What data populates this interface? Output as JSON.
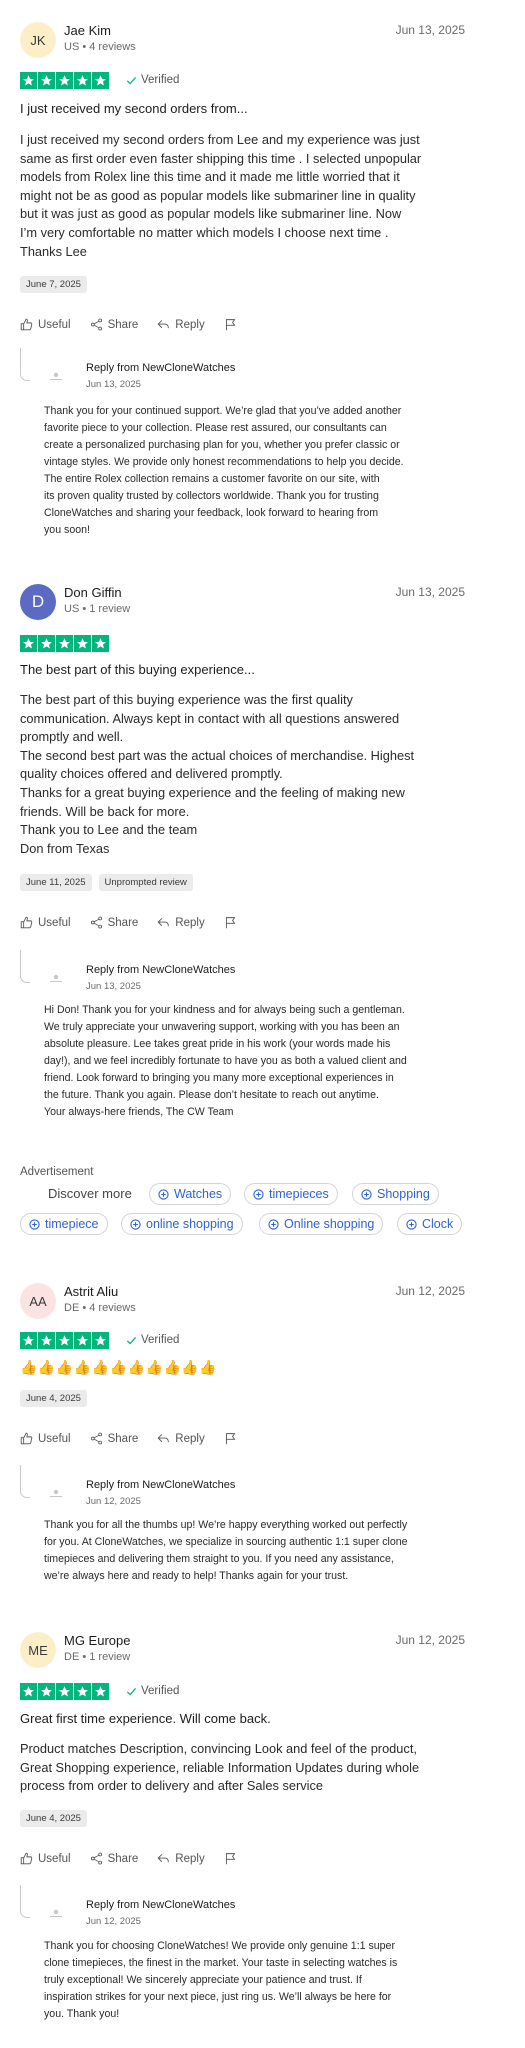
{
  "reviews": [
    {
      "initials": "JK",
      "avatar_color": "#fcefc7",
      "name": "Jae Kim",
      "meta": "US • 4 reviews",
      "date": "Jun 13, 2025",
      "rating": 5,
      "verified": "Verified",
      "title": "I just received my second orders from...",
      "body_lines": [
        "I just received my second orders from Lee and my experience was just",
        "same as first order even faster shipping this time . I selected unpopular",
        "models from Rolex line this time and it made me little worried that it",
        "might not be as good as popular models like submariner line in quality",
        "but it was just as good as popular models like submariner line. Now",
        "I’m very comfortable no matter which models I choose next time .",
        "Thanks Lee"
      ],
      "chips": [
        "June 7, 2025"
      ],
      "actions": {
        "useful": "Useful",
        "share": "Share",
        "reply": "Reply"
      },
      "reply": {
        "title": "Reply from NewCloneWatches",
        "date": "Jun 13, 2025",
        "lines": [
          "Thank you for your continued support. We’re glad that you’ve added another",
          "favorite piece to your collection. Please rest assured, our consultants can",
          "create a personalized purchasing plan for you, whether you prefer classic or",
          "vintage styles. We provide only honest recommendations to help you decide.",
          "The entire Rolex collection remains a customer favorite on our site, with",
          "its proven quality trusted by collectors worldwide. Thank you for trusting",
          "CloneWatches and sharing your feedback, look forward to hearing from",
          "you soon!"
        ]
      }
    },
    {
      "initials": "D",
      "avatar_color": "#5b6bc4",
      "name": "Don Giffin",
      "meta": "US • 1 review",
      "date": "Jun 13, 2025",
      "rating": 5,
      "title": "The best part of this buying experience...",
      "body_lines": [
        "The best part of this buying experience was the first quality",
        "communication. Always kept in contact with all questions answered",
        "promptly and well.",
        "The second best part was the actual choices of merchandise. Highest",
        "quality choices offered and delivered promptly.",
        "Thanks for a great buying experience and the feeling of making new",
        "friends. Will be back for more.",
        "Thank you to Lee and the team",
        "Don from Texas"
      ],
      "chips": [
        "June 11, 2025",
        "Unprompted review"
      ],
      "actions": {
        "useful": "Useful",
        "share": "Share",
        "reply": "Reply"
      },
      "reply": {
        "title": "Reply from NewCloneWatches",
        "date": "Jun 13, 2025",
        "lines": [
          "Hi Don! Thank you for your kindness and for always being such a gentleman.",
          "We truly appreciate your unwavering support, working with you has been an",
          "absolute pleasure. Lee takes great pride in his work (your words made his",
          "day!), and we feel incredibly fortunate to have you as both a valued client and",
          "friend. Look forward to bringing you many more exceptional experiences in",
          "the future. Thank you again. Please don’t hesitate to reach out anytime.",
          "Your always-here friends, The CW Team"
        ]
      }
    },
    {
      "initials": "AA",
      "avatar_color": "#fbe3e3",
      "name": "Astrit Aliu",
      "meta": "DE • 4 reviews",
      "date": "Jun 12, 2025",
      "rating": 5,
      "verified": "Verified",
      "thumbs": "👍👍👍👍👍👍👍👍👍👍👍",
      "chips": [
        "June 4, 2025"
      ],
      "actions": {
        "useful": "Useful",
        "share": "Share",
        "reply": "Reply"
      },
      "reply": {
        "title": "Reply from NewCloneWatches",
        "date": "Jun 12, 2025",
        "lines": [
          "Thank you for all the thumbs up! We’re happy everything worked out perfectly",
          "for you. At CloneWatches, we specialize in sourcing authentic 1:1 super clone",
          "timepieces and delivering them straight to you. If you need any assistance,",
          "we’re always here and ready to help! Thanks again for your trust."
        ]
      }
    },
    {
      "initials": "ME",
      "avatar_color": "#fcefc7",
      "name": "MG Europe",
      "meta": "DE • 1 review",
      "date": "Jun 12, 2025",
      "rating": 5,
      "verified": "Verified",
      "title": "Great first time experience. Will come back.",
      "body_lines": [
        "Product matches Description, convincing Look and feel of the product,",
        "Great Shopping experience, reliable Information Updates during whole",
        "process from order to delivery and after Sales service"
      ],
      "chips": [
        "June 4, 2025"
      ],
      "actions": {
        "useful": "Useful",
        "share": "Share",
        "reply": "Reply"
      },
      "reply": {
        "title": "Reply from NewCloneWatches",
        "date": "Jun 12, 2025",
        "lines": [
          "Thank you for choosing CloneWatches! We provide only genuine 1:1 super",
          "clone timepieces, the finest in the market. Your taste in selecting watches is",
          "truly exceptional! We sincerely appreciate your patience and trust. If",
          "inspiration strikes for your next piece, just ring us. We’ll always be here for",
          "you. Thank you!"
        ]
      }
    }
  ],
  "advertisement": {
    "label": "Advertisement",
    "discover": "Discover more",
    "tags": [
      "Watches",
      "timepieces",
      "Shopping",
      "timepiece",
      "online shopping",
      "Online shopping",
      "Clock"
    ],
    "link_color": "#2e63cf"
  },
  "colors": {
    "star_green": "#00b67a",
    "verified_check": "#00b67a"
  },
  "icons": {
    "useful": "thumbs-up-icon",
    "share": "share-icon",
    "reply": "reply-arrow-icon",
    "flag": "flag-icon",
    "tag": "plus-circle-icon"
  }
}
